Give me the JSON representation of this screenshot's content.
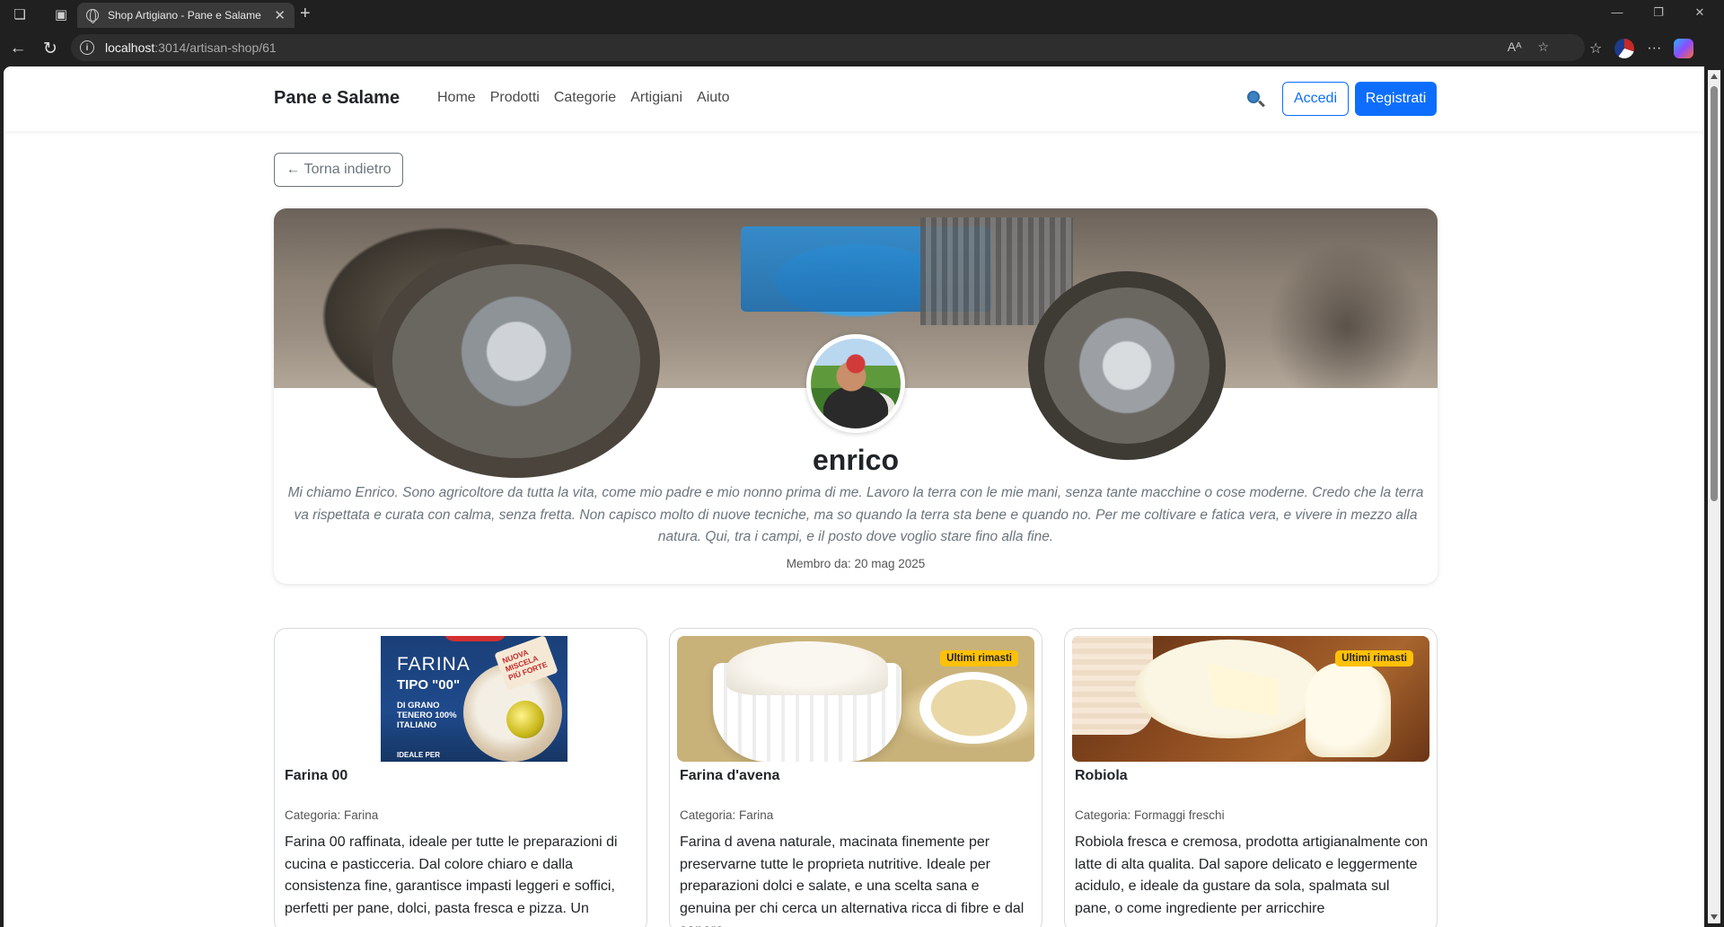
{
  "browser": {
    "tab_title": "Shop Artigiano - Pane e Salame",
    "url_host": "localhost",
    "url_path": ":3014/artisan-shop/61"
  },
  "site": {
    "brand": "Pane e Salame",
    "nav": [
      "Home",
      "Prodotti",
      "Categorie",
      "Artigiani",
      "Aiuto"
    ],
    "login": "Accedi",
    "register": "Registrati"
  },
  "back_label": "← Torna indietro",
  "artisan": {
    "name": "enrico",
    "bio": "Mi chiamo Enrico. Sono agricoltore da tutta la vita, come mio padre e mio nonno prima di me. Lavoro la terra con le mie mani, senza tante macchine o cose moderne. Credo che la terra va rispettata e curata con calma, senza fretta. Non capisco molto di nuove tecniche, ma so quando la terra sta bene e quando no. Per me coltivare e fatica vera, e vivere in mezzo alla natura. Qui, tra i campi, e il posto dove voglio stare fino alla fine.",
    "member_since": "Membro da: 20 mag 2025"
  },
  "products": [
    {
      "name": "Farina 00",
      "category": "Categoria: Farina",
      "badge": "",
      "description": "Farina 00 raffinata, ideale per tutte le preparazioni di cucina e pasticceria. Dal colore chiaro e dalla consistenza fine, garantisce impasti leggeri e soffici, perfetti per pane, dolci, pasta fresca e pizza. Un",
      "package_text": {
        "line1": "FARINA",
        "line2": "TIPO \"00\"",
        "line3": "DI GRANO TENERO 100% ITALIANO",
        "line4": "IDEALE PER",
        "sticker": "NUOVA MISCELA PIÙ FORTE"
      }
    },
    {
      "name": "Farina d'avena",
      "category": "Categoria: Farina",
      "badge": "Ultimi rimasti",
      "description": "Farina d avena naturale, macinata finemente per preservarne tutte le proprieta nutritive. Ideale per preparazioni dolci e salate, e una scelta sana e genuina per chi cerca un alternativa ricca di fibre e dal sapore"
    },
    {
      "name": "Robiola",
      "category": "Categoria: Formaggi freschi",
      "badge": "Ultimi rimasti",
      "description": "Robiola fresca e cremosa, prodotta artigianalmente con latte di alta qualita. Dal sapore delicato e leggermente acidulo, e ideale da gustare da sola, spalmata sul pane, o come ingrediente per arricchire"
    }
  ],
  "colors": {
    "primary": "#0d6efd",
    "badge": "#ffc107",
    "muted": "#6c757d"
  }
}
